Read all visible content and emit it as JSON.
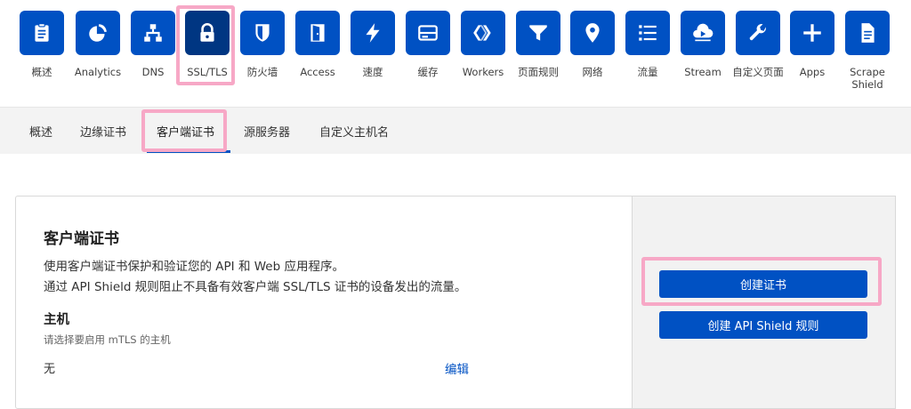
{
  "apps": [
    {
      "id": "overview",
      "label": "概述",
      "icon": "clipboard-icon"
    },
    {
      "id": "analytics",
      "label": "Analytics",
      "icon": "pie-chart-icon"
    },
    {
      "id": "dns",
      "label": "DNS",
      "icon": "network-icon"
    },
    {
      "id": "ssl",
      "label": "SSL/TLS",
      "icon": "lock-icon",
      "active": true
    },
    {
      "id": "firewall",
      "label": "防火墙",
      "icon": "shield-icon"
    },
    {
      "id": "access",
      "label": "Access",
      "icon": "door-icon"
    },
    {
      "id": "speed",
      "label": "速度",
      "icon": "lightning-icon"
    },
    {
      "id": "cache",
      "label": "缓存",
      "icon": "server-icon"
    },
    {
      "id": "workers",
      "label": "Workers",
      "icon": "workers-icon"
    },
    {
      "id": "page-rules",
      "label": "页面规则",
      "icon": "filter-icon"
    },
    {
      "id": "network",
      "label": "网络",
      "icon": "location-pin-icon"
    },
    {
      "id": "traffic",
      "label": "流量",
      "icon": "list-icon"
    },
    {
      "id": "stream",
      "label": "Stream",
      "icon": "cloud-play-icon"
    },
    {
      "id": "custom-pages",
      "label": "自定义页面",
      "icon": "wrench-icon"
    },
    {
      "id": "apps",
      "label": "Apps",
      "icon": "plus-icon"
    },
    {
      "id": "scrape-shield",
      "label": "Scrape\nShield",
      "icon": "document-icon"
    }
  ],
  "subnav": {
    "tabs": [
      {
        "label": "概述"
      },
      {
        "label": "边缘证书"
      },
      {
        "label": "客户端证书",
        "active": true
      },
      {
        "label": "源服务器"
      },
      {
        "label": "自定义主机名"
      }
    ]
  },
  "card": {
    "title": "客户端证书",
    "desc_line1": "使用客户端证书保护和验证您的 API 和 Web 应用程序。",
    "desc_line2": "通过 API Shield 规则阻止不具备有效客户端 SSL/TLS 证书的设备发出的流量。",
    "host_title": "主机",
    "host_hint": "请选择要启用 mTLS 的主机",
    "host_value": "无",
    "edit_label": "编辑",
    "create_cert_label": "创建证书",
    "create_rule_label": "创建 API Shield 规则"
  },
  "colors": {
    "accent": "#0051c3",
    "active_tile": "#003682",
    "highlight": "#f7a8c6"
  }
}
